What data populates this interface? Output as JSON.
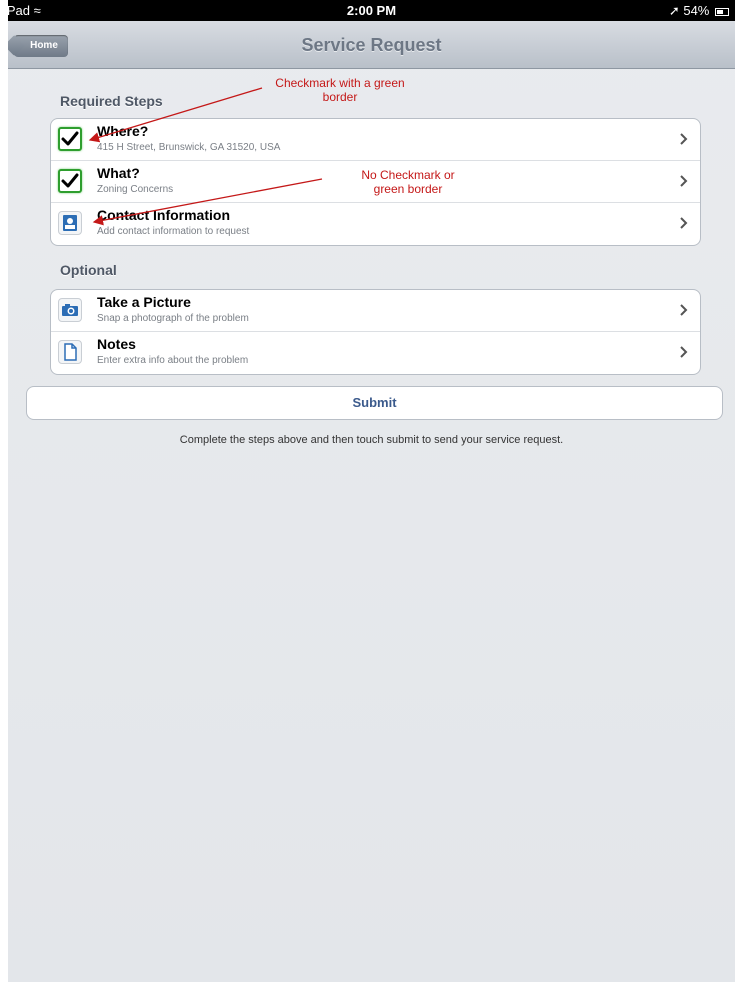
{
  "status_bar": {
    "device": "iPad",
    "time": "2:00 PM",
    "battery": "54%"
  },
  "nav": {
    "back_label": "Home",
    "title": "Service Request"
  },
  "required": {
    "label": "Required Steps",
    "items": [
      {
        "title": "Where?",
        "subtitle": "415 H Street, Brunswick, GA 31520, USA",
        "icon": "checkmark-icon"
      },
      {
        "title": "What?",
        "subtitle": "Zoning Concerns",
        "icon": "checkmark-icon"
      },
      {
        "title": "Contact Information",
        "subtitle": "Add contact information to request",
        "icon": "contact-card-icon"
      }
    ]
  },
  "optional": {
    "label": "Optional",
    "items": [
      {
        "title": "Take a Picture",
        "subtitle": "Snap a photograph of the problem",
        "icon": "camera-icon"
      },
      {
        "title": "Notes",
        "subtitle": "Enter extra info about the problem",
        "icon": "document-icon"
      }
    ]
  },
  "submit_label": "Submit",
  "help_text": "Complete the steps above and then touch submit to send your service request.",
  "annotations": {
    "first": "Checkmark with a green border",
    "second": "No Checkmark or green border"
  },
  "colors": {
    "check_border": "#2e9e2e",
    "annotation": "#c41818",
    "submit_text": "#3b5a8c"
  }
}
